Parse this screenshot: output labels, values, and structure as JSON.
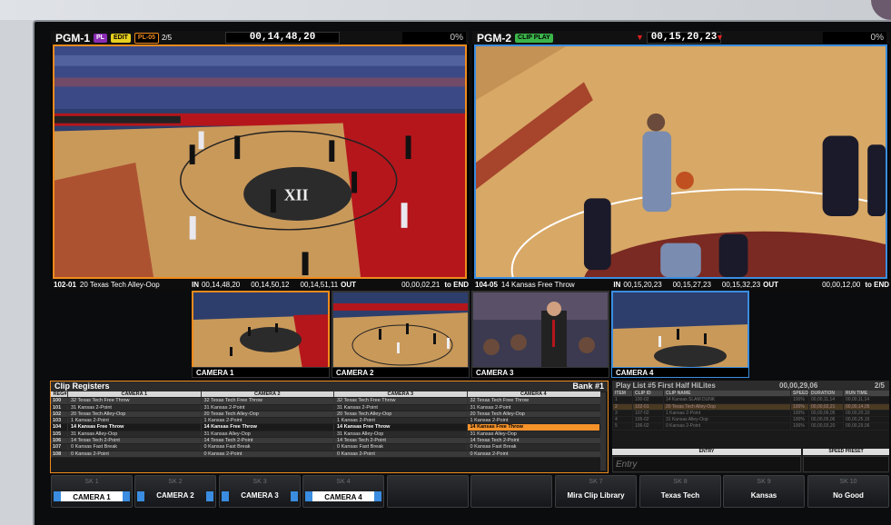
{
  "pgm1": {
    "name": "PGM-1",
    "badges": {
      "pl": "PL",
      "edit": "EDIT",
      "plref": "PL-05",
      "count": "2/5"
    },
    "timecode": "00,14,48,20",
    "percent": "0%",
    "footer": {
      "clip_id": "102-01",
      "clip_name": "20 Texas Tech Alley-Oop",
      "in_label": "IN",
      "in": "00,14,48,20",
      "mid": "00,14,50,12",
      "out_tc": "00,14,51,11",
      "out_label": "OUT",
      "duration": "00,00,02,21",
      "end": "to END"
    }
  },
  "pgm2": {
    "name": "PGM-2",
    "badge": "CLIP PLAY",
    "timecode": "00,15,20,23",
    "percent": "0%",
    "footer": {
      "clip_id": "104-05",
      "clip_name": "14 Kansas Free Throw",
      "in_label": "IN",
      "in": "00,15,20,23",
      "mid": "00,15,27,23",
      "out_tc": "00,15,32,23",
      "out_label": "OUT",
      "duration": "00,00,12,00",
      "end": "to END"
    }
  },
  "cameras": [
    "CAMERA 1",
    "CAMERA 2",
    "CAMERA 3",
    "CAMERA 4"
  ],
  "registers": {
    "title": "Clip Registers",
    "bank": "Bank #1",
    "columns": [
      "REG#",
      "CAMERA 1",
      "CAMERA 2",
      "CAMERA 3",
      "CAMERA 4"
    ],
    "rows": [
      {
        "reg": "100",
        "clip": "32 Texas Tech Free Throw"
      },
      {
        "reg": "101",
        "clip": "31 Kansas 2-Point"
      },
      {
        "reg": "102",
        "clip": "20 Texas Tech Alley-Oop"
      },
      {
        "reg": "103",
        "clip": "1 Kansas 2-Point"
      },
      {
        "reg": "104",
        "clip": "14 Kansas Free Throw"
      },
      {
        "reg": "105",
        "clip": "31 Kansas Alley-Oop"
      },
      {
        "reg": "106",
        "clip": "14 Texas Tech 2-Point"
      },
      {
        "reg": "107",
        "clip": "0 Kansas Fast Break"
      },
      {
        "reg": "108",
        "clip": "0 Kansas 2-Point"
      }
    ]
  },
  "playlist": {
    "title": "Play List #5 First Half HiLites",
    "timecode": "00,00,29,06",
    "page": "2/5",
    "columns": [
      "ITEM",
      "CLIP ID",
      "CLIP NAME",
      "SPEED",
      "DURATION",
      "RUN TIME"
    ],
    "rows": [
      {
        "item": "1",
        "id": "100-02",
        "name": "14 Kansas SLAM DUNK",
        "speed": "100%",
        "dur": "00,00,11,14",
        "run": "00,00,11,14"
      },
      {
        "item": "2",
        "id": "102-01",
        "name": "20 Texas Tech Alley-Oop",
        "speed": "100%",
        "dur": "00,00,02,21",
        "run": "00,00,14,05"
      },
      {
        "item": "3",
        "id": "107-02",
        "name": "1 Kansas 2-Point",
        "speed": "100%",
        "dur": "00,00,06,05",
        "run": "00,00,20,10"
      },
      {
        "item": "4",
        "id": "105-02",
        "name": "31 Kansas Alley-Oop",
        "speed": "100%",
        "dur": "00,00,05,06",
        "run": "00,00,25,16"
      },
      {
        "item": "5",
        "id": "106-02",
        "name": "0 Kansas 2-Point",
        "speed": "100%",
        "dur": "00,00,03,20",
        "run": "00,00,29,06"
      }
    ],
    "entry_label": "ENTRY",
    "speed_preset_label": "SPEED PRESET",
    "entry_placeholder": "Entry"
  },
  "softkeys": [
    {
      "num": "SK 1",
      "label": "CAMERA 1"
    },
    {
      "num": "SK 2",
      "label": "CAMERA 2"
    },
    {
      "num": "SK 3",
      "label": "CAMERA 3"
    },
    {
      "num": "SK 4",
      "label": "CAMERA 4"
    },
    {
      "num": "",
      "label": ""
    },
    {
      "num": "",
      "label": ""
    },
    {
      "num": "SK 7",
      "label": "Mira Clip Library"
    },
    {
      "num": "SK 8",
      "label": "Texas Tech"
    },
    {
      "num": "SK 9",
      "label": "Kansas"
    },
    {
      "num": "SK 10",
      "label": "No Good"
    }
  ],
  "colors": {
    "accent_orange": "#f08a1c",
    "accent_blue": "#3a8de0",
    "pl_purple": "#8a2bb4",
    "edit_yellow": "#e8d020",
    "clipplay_green": "#3bb54a",
    "highlight": "#f5922a"
  }
}
